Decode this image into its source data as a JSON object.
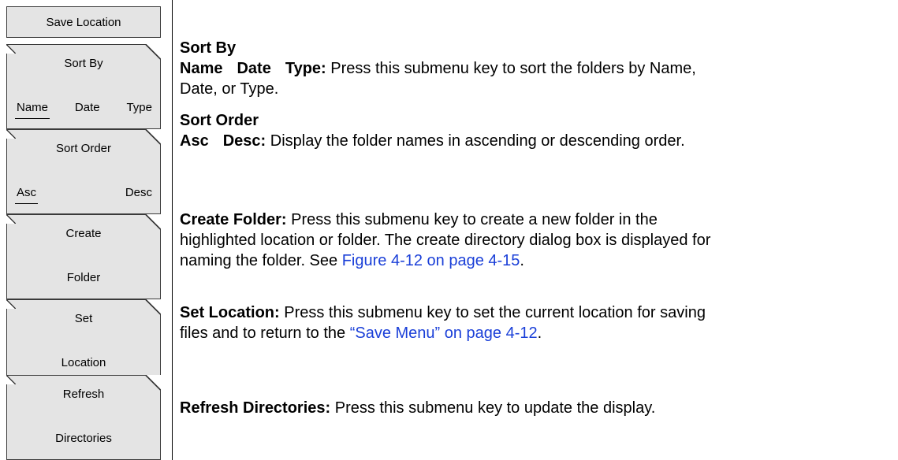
{
  "menu": {
    "title": "Save Location",
    "sort_by": {
      "label": "Sort By",
      "options": [
        "Name",
        "Date",
        "Type"
      ],
      "selected": "Name"
    },
    "sort_order": {
      "label": "Sort Order",
      "options": [
        "Asc",
        "Desc"
      ],
      "selected": "Asc"
    },
    "create_folder": {
      "line1": "Create",
      "line2": "Folder"
    },
    "set_location": {
      "line1": "Set",
      "line2": "Location"
    },
    "refresh": {
      "line1": "Refresh",
      "line2": "Directories"
    }
  },
  "descriptions": {
    "sort_by": {
      "heading": "Sort By",
      "opt1": "Name",
      "opt2": "Date",
      "opt3": "Type:",
      "text_line1": "Press this submenu key to sort the folders by Name,",
      "text_line2": "Date, or Type."
    },
    "sort_order": {
      "heading": "Sort Order",
      "opt1": "Asc",
      "opt2": "Desc:",
      "text": "Display the folder names in ascending or descending order."
    },
    "create_folder": {
      "term": "Create Folder:",
      "line1": "Press this submenu key to create a new folder in the",
      "line2": "highlighted location or folder. The create directory dialog box is displayed for",
      "line3": "naming the folder. See",
      "link": "Figure 4-12 on page 4-15",
      "end": "."
    },
    "set_location": {
      "term": "Set Location:",
      "line1": "Press this submenu key to set the current location for saving",
      "line2": "files and to return to the",
      "link": "“Save Menu” on page 4-12",
      "end": "."
    },
    "refresh": {
      "term": "Refresh Directories:",
      "text": "Press this submenu key to update the display."
    }
  }
}
